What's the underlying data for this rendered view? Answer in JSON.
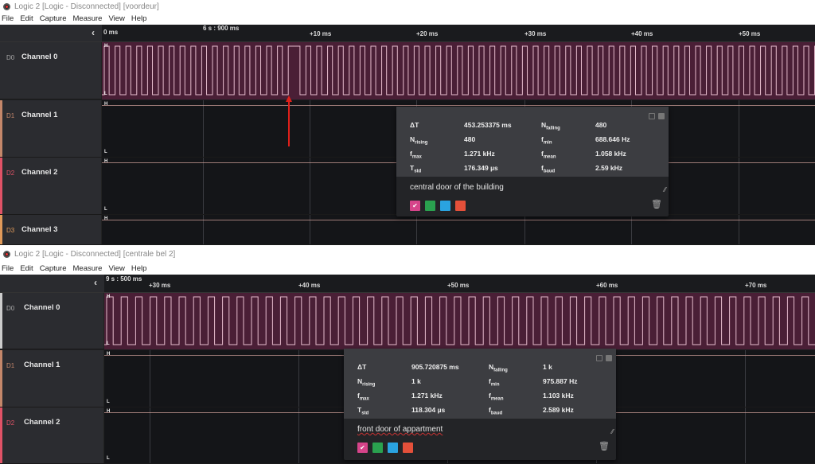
{
  "colors": {
    "accent_wave": "#4a1f36",
    "wave_line": "#e6bccd",
    "d1": "#c4876a",
    "d2": "#e05266",
    "d3": "#e09a5a",
    "swatch_pink": "#d6448a",
    "swatch_green": "#2aa14f",
    "swatch_blue": "#2aa3e0",
    "swatch_red": "#e4503a",
    "arrow": "#e0201a"
  },
  "windows": [
    {
      "title": "Logic 2 [Logic - Disconnected] [voordeur]",
      "menu": [
        "File",
        "Edit",
        "Capture",
        "Measure",
        "View",
        "Help"
      ],
      "time_labels": [
        "0 ms",
        "6 s : 900 ms",
        "+10 ms",
        "+20 ms",
        "+30 ms",
        "+40 ms",
        "+50 ms"
      ],
      "channels": [
        {
          "id": "D0",
          "name": "Channel 0"
        },
        {
          "id": "D1",
          "name": "Channel 1"
        },
        {
          "id": "D2",
          "name": "Channel 2"
        },
        {
          "id": "D3",
          "name": "Channel 3"
        }
      ],
      "measurement": {
        "rows": [
          [
            "ΔT",
            "453.253375 ms",
            "N",
            "falling",
            "480"
          ],
          [
            "N",
            "rising",
            "480"
          ],
          [
            "f",
            "max",
            "1.271 kHz"
          ],
          [
            "T",
            "std",
            "176.349 µs"
          ]
        ],
        "stats": [
          {
            "k": "ΔT",
            "s": "",
            "v": "453.253375 ms"
          },
          {
            "k": "N",
            "s": "falling",
            "v": "480"
          },
          {
            "k": "N",
            "s": "rising",
            "v": "480"
          },
          {
            "k": "f",
            "s": "min",
            "v": "688.646 Hz"
          },
          {
            "k": "f",
            "s": "max",
            "v": "1.271 kHz"
          },
          {
            "k": "f",
            "s": "mean",
            "v": "1.058 kHz"
          },
          {
            "k": "T",
            "s": "std",
            "v": "176.349 µs"
          },
          {
            "k": "f",
            "s": "baud",
            "v": "2.59 kHz"
          }
        ],
        "note": "central door of the building"
      }
    },
    {
      "title": "Logic 2 [Logic - Disconnected] [centrale bel 2]",
      "menu": [
        "File",
        "Edit",
        "Capture",
        "Measure",
        "View",
        "Help"
      ],
      "time_labels": [
        "9 s : 500 ms",
        "+30 ms",
        "+40 ms",
        "+50 ms",
        "+60 ms",
        "+70 ms"
      ],
      "channels": [
        {
          "id": "D0",
          "name": "Channel 0"
        },
        {
          "id": "D1",
          "name": "Channel 1"
        },
        {
          "id": "D2",
          "name": "Channel 2"
        }
      ],
      "measurement": {
        "stats": [
          {
            "k": "ΔT",
            "s": "",
            "v": "905.720875 ms"
          },
          {
            "k": "N",
            "s": "falling",
            "v": "1 k"
          },
          {
            "k": "N",
            "s": "rising",
            "v": "1 k"
          },
          {
            "k": "f",
            "s": "min",
            "v": "975.887 Hz"
          },
          {
            "k": "f",
            "s": "max",
            "v": "1.271 kHz"
          },
          {
            "k": "f",
            "s": "mean",
            "v": "1.103 kHz"
          },
          {
            "k": "T",
            "s": "std",
            "v": "118.304 µs"
          },
          {
            "k": "f",
            "s": "baud",
            "v": "2.589 kHz"
          }
        ],
        "note": "front door of appartment"
      }
    }
  ],
  "level_labels": {
    "high": "H",
    "low": "L"
  }
}
